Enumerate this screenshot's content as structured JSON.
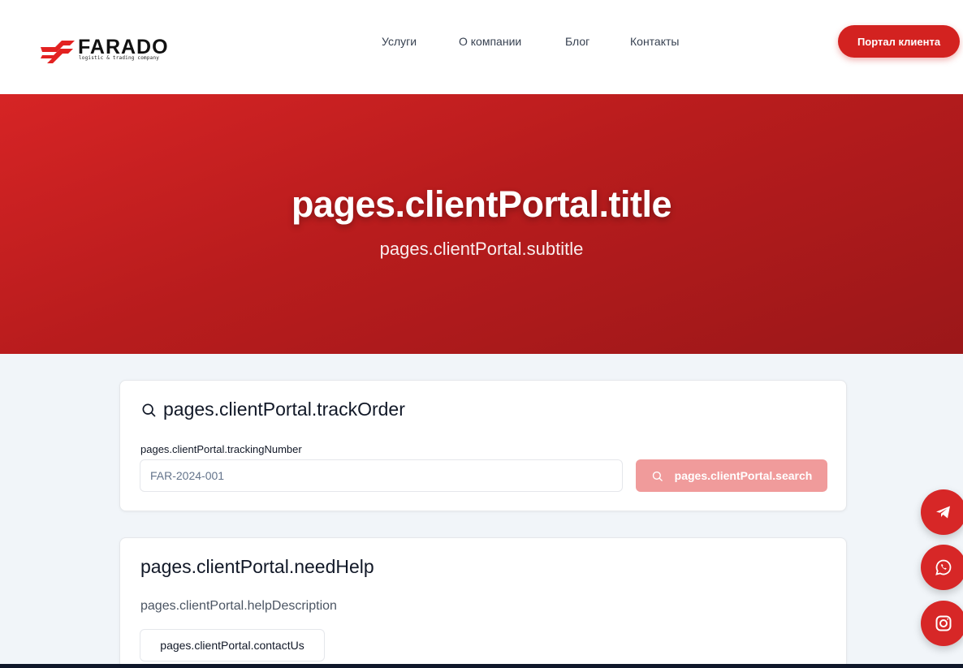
{
  "brand": {
    "name": "FARADO",
    "tagline": "logistic & trading company",
    "accent_color": "#d32220"
  },
  "nav": {
    "items": [
      {
        "label": "Услуги"
      },
      {
        "label": "О компании"
      },
      {
        "label": "Блог"
      },
      {
        "label": "Контакты"
      }
    ],
    "portal_button": "Портал клиента"
  },
  "hero": {
    "title": "pages.clientPortal.title",
    "subtitle": "pages.clientPortal.subtitle"
  },
  "track": {
    "title": "pages.clientPortal.trackOrder",
    "title_icon": "search-icon",
    "field_label": "pages.clientPortal.trackingNumber",
    "input_value": "",
    "input_placeholder": "FAR-2024-001",
    "search_button": "pages.clientPortal.search",
    "search_button_icon": "search-icon",
    "search_button_color": "#f09b9b"
  },
  "help": {
    "title": "pages.clientPortal.needHelp",
    "description": "pages.clientPortal.helpDescription",
    "contact_button": "pages.clientPortal.contactUs"
  },
  "social": [
    {
      "icon": "telegram-icon"
    },
    {
      "icon": "whatsapp-icon"
    },
    {
      "icon": "instagram-icon"
    }
  ]
}
